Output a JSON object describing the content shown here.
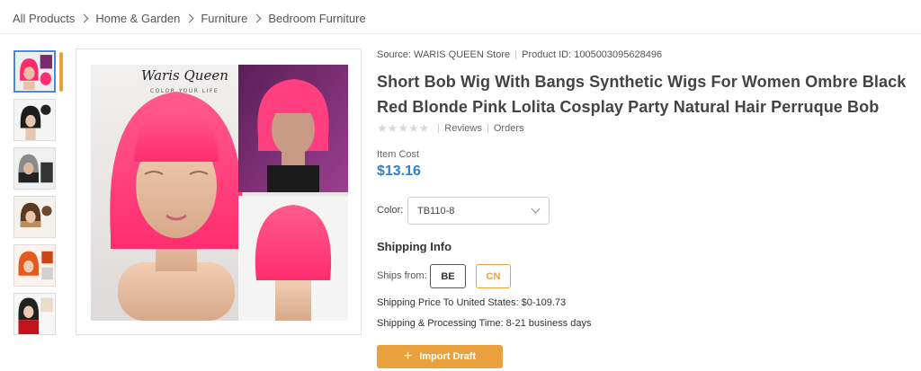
{
  "breadcrumb": [
    "All Products",
    "Home & Garden",
    "Furniture",
    "Bedroom Furniture"
  ],
  "product": {
    "source": "Source: WARIS QUEEN Store",
    "product_id": "Product ID: 1005003095628496",
    "title": "Short Bob Wig With Bangs Synthetic Wigs For Women Ombre Black Red Blonde Pink Lolita Cosplay Party Natural Hair Perruque Bob",
    "rating_stars": 0,
    "reviews_label": "Reviews",
    "orders_label": "Orders",
    "cost_label": "Item Cost",
    "cost_value": "$13.16"
  },
  "brand": {
    "logo_text": "Waris Queen",
    "logo_tagline": "COLOR YOUR LIFE"
  },
  "color": {
    "label": "Color:",
    "selected": "TB110-8"
  },
  "shipping": {
    "heading": "Shipping Info",
    "ships_from_label": "Ships from:",
    "options": [
      "BE",
      "CN"
    ],
    "selected_option": "CN",
    "price_text": "Shipping Price To United States:  $0-109.73",
    "time_text": "Shipping & Processing Time:  8-21 business days"
  },
  "actions": {
    "import_label": "Import Draft"
  },
  "colors": {
    "accent": "#e8a13e",
    "price_blue": "#2f7fd1",
    "active_thumb_border": "#4a86e8",
    "wig_pink": "#ff2d6f"
  },
  "thumbnails": [
    "pink-bob",
    "black-bob",
    "grey-black",
    "brown-ombre",
    "orange-bob",
    "blonde-red"
  ]
}
